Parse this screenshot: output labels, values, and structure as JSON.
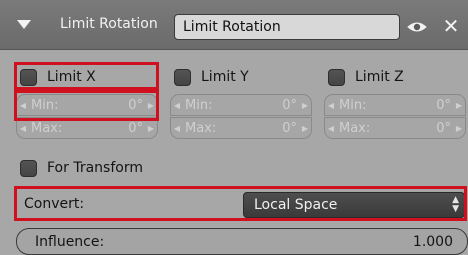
{
  "header": {
    "title": "Limit Rotation",
    "name_value": "Limit Rotation",
    "eye_icon": "eye-icon",
    "close_icon": "close-icon",
    "close_glyph": "✕"
  },
  "axes": [
    {
      "checkbox_label": "Limit X",
      "min_label": "Min:",
      "min_value": "0°",
      "max_label": "Max:",
      "max_value": "0°"
    },
    {
      "checkbox_label": "Limit Y",
      "min_label": "Min:",
      "min_value": "0°",
      "max_label": "Max:",
      "max_value": "0°"
    },
    {
      "checkbox_label": "Limit Z",
      "min_label": "Min:",
      "min_value": "0°",
      "max_label": "Max:",
      "max_value": "0°"
    }
  ],
  "for_transform_label": "For Transform",
  "convert": {
    "label": "Convert:",
    "value": "Local Space"
  },
  "influence": {
    "label": "Influence:",
    "value": "1.000"
  },
  "colors": {
    "highlight": "#d0101e",
    "panel_bg": "#a7a7a7",
    "header_bg": "#6e6e6e"
  }
}
